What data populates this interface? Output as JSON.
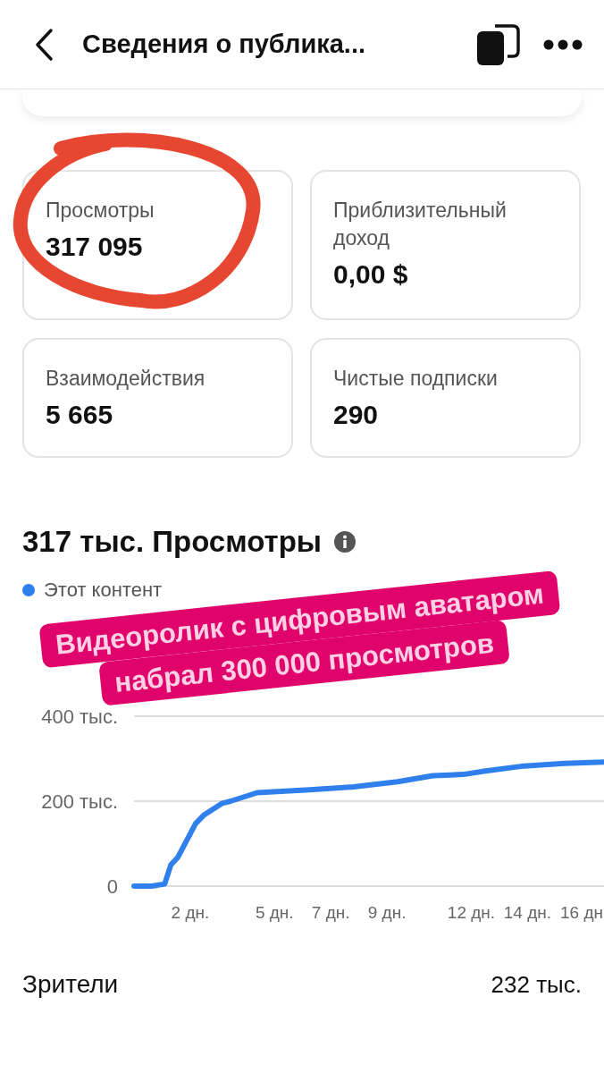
{
  "header": {
    "title": "Сведения о публика..."
  },
  "stats": [
    {
      "label": "Просмотры",
      "value": "317 095"
    },
    {
      "label": "Приблизительный доход",
      "value": "0,00 $"
    },
    {
      "label": "Взаимодействия",
      "value": "5 665"
    },
    {
      "label": "Чистые подписки",
      "value": "290"
    }
  ],
  "views_section": {
    "heading": "317 тыс. Просмотры",
    "chart_data": {
      "type": "line",
      "x": [
        0,
        0.63,
        1.09,
        1.31,
        1.56,
        2.19,
        2.5,
        3.13,
        3.44,
        4.38,
        6.25,
        7.81,
        9.38,
        10.63,
        11.72,
        12.5,
        13.75,
        15.31,
        16.72
      ],
      "series": [
        {
          "name": "Этот контент",
          "color": "#2f80ed",
          "values": [
            0,
            0,
            5,
            50,
            68,
            147,
            168,
            195,
            200,
            220,
            227,
            234,
            246,
            260,
            263,
            271,
            282,
            289,
            292
          ]
        }
      ],
      "xlim": [
        0,
        16.72
      ],
      "ylim": [
        0,
        400
      ],
      "yticks": [
        {
          "value": 0,
          "label": "0"
        },
        {
          "value": 200,
          "label": "200 тыс."
        },
        {
          "value": 400,
          "label": "400 тыс."
        }
      ],
      "xticks": [
        {
          "value": 2,
          "label": "2 дн."
        },
        {
          "value": 5,
          "label": "5 дн."
        },
        {
          "value": 7,
          "label": "7 дн."
        },
        {
          "value": 9,
          "label": "9 дн."
        },
        {
          "value": 12,
          "label": "12 дн."
        },
        {
          "value": 14,
          "label": "14 дн."
        },
        {
          "value": 16,
          "label": "16 дн"
        }
      ]
    }
  },
  "audience": {
    "label": "Зрители",
    "value": "232 тыс."
  },
  "overlay": {
    "caption_lines": [
      "Видеоролик с цифровым аватаром",
      "набрал 300 000 просмотров"
    ]
  }
}
